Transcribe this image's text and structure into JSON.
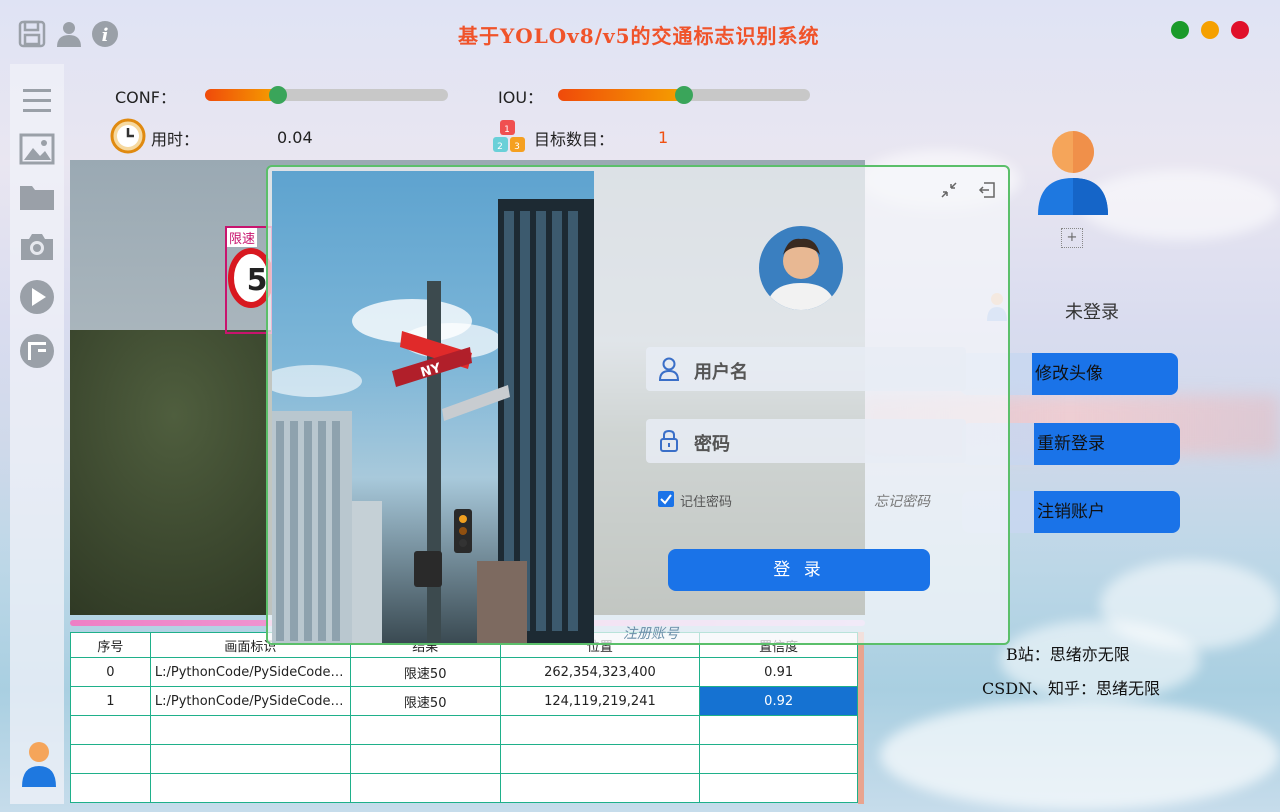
{
  "window": {
    "title": "基于YOLOv8/v5的交通标志识别系统",
    "colors": {
      "close": "#e0102a",
      "minimize": "#f5a000",
      "maximize": "#1a9a2a",
      "title": "#f0532a"
    }
  },
  "controls": {
    "conf_label": "CONF：",
    "conf_value": 0.3,
    "iou_label": "IOU：",
    "iou_value": 0.5,
    "time_label": "用时：",
    "time_value": "0.04",
    "count_label": "目标数目：",
    "count_value": "1"
  },
  "detection": {
    "sign_label": "限速"
  },
  "table": {
    "headers": [
      "序号",
      "画面标识",
      "结果",
      "位置",
      "置信度"
    ],
    "rows": [
      [
        "0",
        "L:/PythonCode/PySideCode/...",
        "限速50",
        "262,354,323,400",
        "0.91"
      ],
      [
        "1",
        "L:/PythonCode/PySideCode/...",
        "限速50",
        "124,119,219,241",
        "0.92"
      ],
      [
        "",
        "",
        "",
        "",
        ""
      ],
      [
        "",
        "",
        "",
        "",
        ""
      ],
      [
        "",
        "",
        "",
        "",
        ""
      ]
    ]
  },
  "login": {
    "username_placeholder": "用户名",
    "password_placeholder": "密码",
    "remember_label": "记住密码",
    "remember_checked": true,
    "forgot_label": "忘记密码",
    "login_button": "登 录",
    "register_link": "注册账号",
    "street_sign": "NY"
  },
  "account": {
    "status": "未登录",
    "avatar_add": "+",
    "change_avatar": "修改头像",
    "relogin": "重新登录",
    "delete_account": "注销账户"
  },
  "credits": {
    "bilibili": "B站：思绪亦无限",
    "csdn": "CSDN、知乎：思绪无限"
  }
}
